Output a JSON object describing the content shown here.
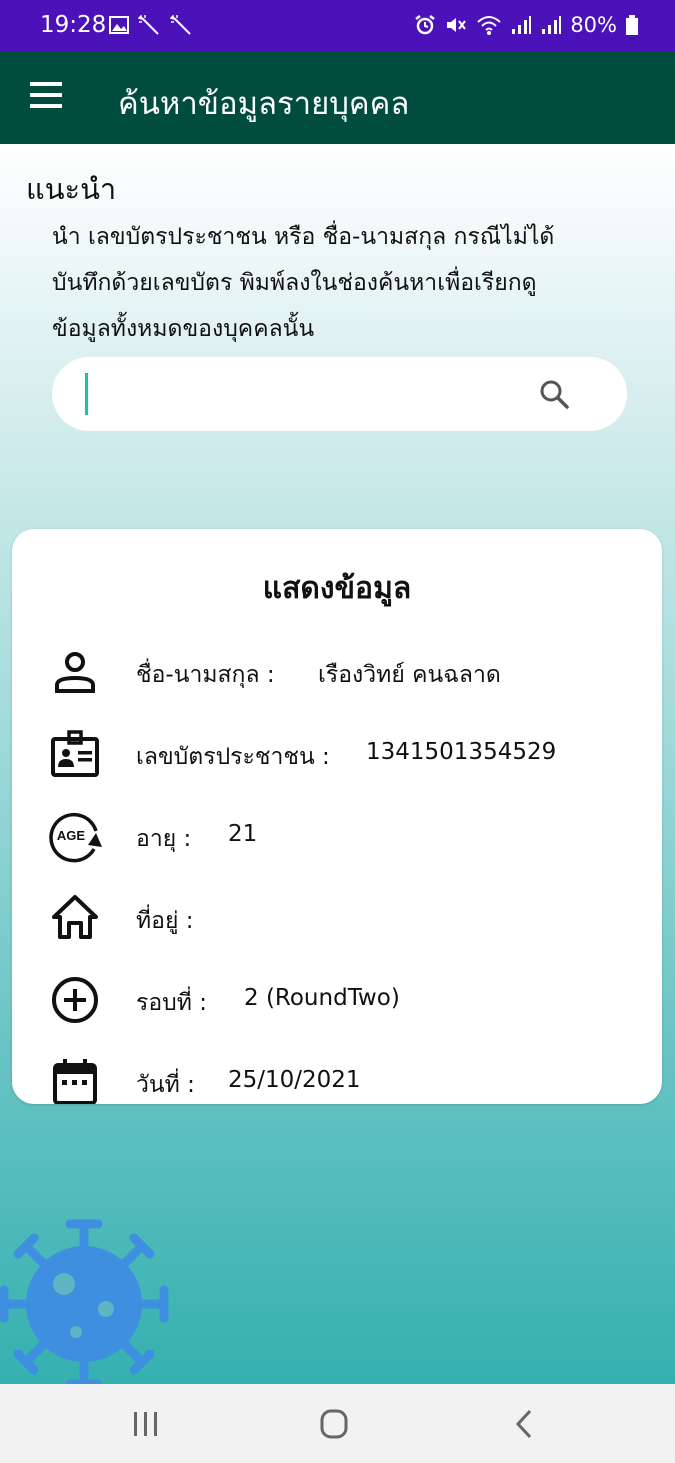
{
  "status_bar": {
    "time": "19:28",
    "battery": "80%"
  },
  "app_bar": {
    "title": "ค้นหาข้อมูลรายบุคคล"
  },
  "intro": {
    "title": "แนะนำ",
    "line1": "นำ เลขบัตรประชาชน หรือ ชื่อ-นามสกุล กรณีไม่ได้",
    "line2": "บันทึกด้วยเลขบัตร พิมพ์ลงในช่องค้นหาเพื่อเรียกดู",
    "line3": "ข้อมูลทั้งหมดของบุคคลนั้น"
  },
  "search": {
    "value": "",
    "placeholder": ""
  },
  "card": {
    "title": "แสดงข้อมูล",
    "rows": [
      {
        "icon": "person-icon",
        "label": "ชื่อ-นามสกุล :",
        "value": "เรืองวิทย์ คนฉลาด"
      },
      {
        "icon": "id-card-icon",
        "label": "เลขบัตรประชาชน :",
        "value": "1341501354529"
      },
      {
        "icon": "age-icon",
        "icon_text": "AGE",
        "label": "อายุ :",
        "value": "21"
      },
      {
        "icon": "home-icon",
        "label": "ที่อยู่ :",
        "value": ""
      },
      {
        "icon": "add-circle-icon",
        "label": "รอบที่ :",
        "value": "2 (RoundTwo)"
      },
      {
        "icon": "calendar-icon",
        "label": "วันที่ :",
        "value": "25/10/2021"
      }
    ]
  },
  "colors": {
    "status_bar": "#4a12b8",
    "app_bar": "#004d40",
    "virus": "#3f8fe0",
    "caret": "#1bbfb0"
  }
}
